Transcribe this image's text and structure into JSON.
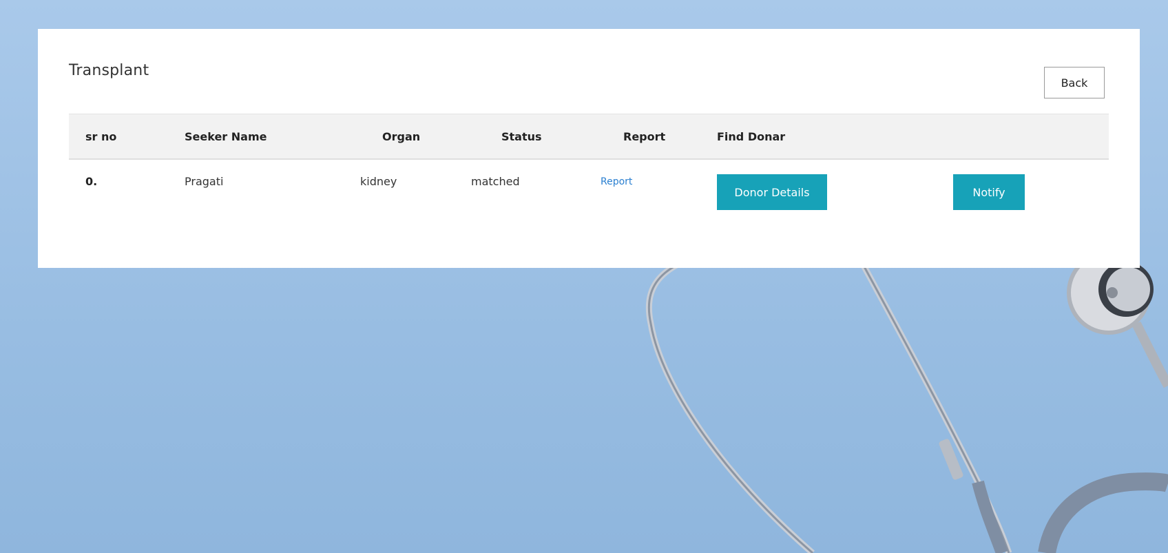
{
  "page": {
    "title": "Transplant",
    "back_label": "Back"
  },
  "table": {
    "headers": [
      "sr no",
      "Seeker Name",
      "Organ",
      "Status",
      "Report",
      "Find Donar",
      ""
    ],
    "rows": [
      {
        "sr_no": "0.",
        "seeker_name": "Pragati",
        "organ": "kidney",
        "status": "matched",
        "report_label": "Report",
        "donor_details_label": "Donor Details",
        "notify_label": "Notify"
      }
    ]
  },
  "colors": {
    "accent": "#17a2b8",
    "link": "#2a7fd0",
    "header_bg": "#f2f2f2",
    "page_bg": "#a1c3e6"
  }
}
